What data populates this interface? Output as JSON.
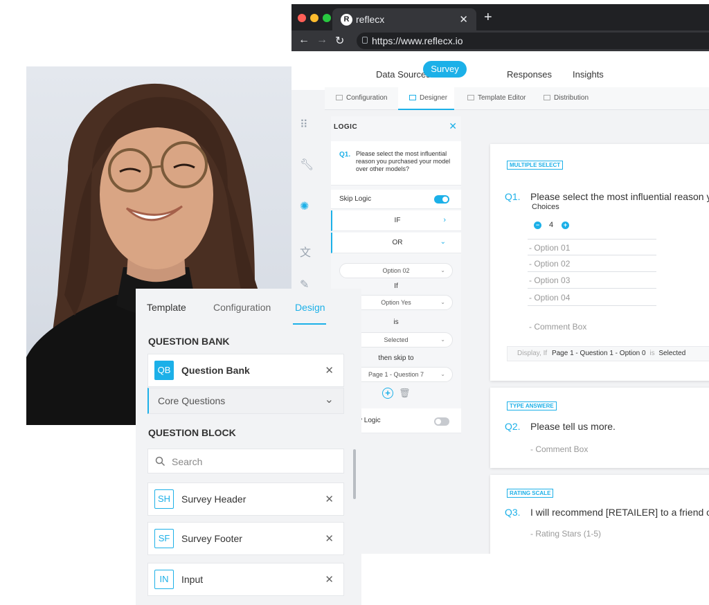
{
  "browser": {
    "tab_title": "reflecx",
    "tab_logo": "R",
    "url": "https://www.reflecx.io"
  },
  "topnav": {
    "items": [
      "Data Sources",
      "Survey",
      "Responses",
      "Insights"
    ],
    "active": "Survey"
  },
  "subtabs": [
    "Configuration",
    "Designer",
    "Template Editor",
    "Distribution"
  ],
  "logic": {
    "title": "LOGIC",
    "question_num": "Q1.",
    "question_text": "Please select the most influential reason you purchased your model over other models?",
    "skip_logic_label": "Skip Logic",
    "skip_logic_on": true,
    "if_label": "IF",
    "or_label": "OR",
    "option_select": "Option 02",
    "if_small": "If",
    "yes_select": "Option Yes",
    "is_label": "is",
    "selected_select": "Selected",
    "then_skip_label": "then skip to",
    "skip_target": "Page 1 - Question 7",
    "display_logic_label": "y Logic",
    "display_logic_on": false
  },
  "canvas": {
    "q1": {
      "type": "MULTIPLE SELECT",
      "num": "Q1.",
      "text": "Please select the most influential reason y",
      "choices_label": "Choices",
      "choices_count": "4",
      "options": [
        "- Option 01",
        "- Option 02",
        "- Option 03",
        "- Option 04"
      ],
      "comment": "- Comment Box",
      "display_prefix": "Display, If",
      "display_value": "Page 1 - Question 1 - Option 0",
      "display_is": "is",
      "display_state": "Selected"
    },
    "q2": {
      "type": "TYPE ANSWERE",
      "num": "Q2.",
      "text": "Please tell us more.",
      "comment": "- Comment Box"
    },
    "q3": {
      "type": "RATING SCALE",
      "num": "Q3.",
      "text": "I will recommend [RETAILER] to a friend o",
      "sub": "- Rating Stars (1-5)"
    }
  },
  "design": {
    "tabs": [
      "Template",
      "Configuration",
      "Design"
    ],
    "active_tab": "Design",
    "question_bank_heading": "QUESTION BANK",
    "qb_badge": "QB",
    "qb_label": "Question Bank",
    "core_questions": "Core Questions",
    "question_block_heading": "QUESTION BLOCK",
    "search_placeholder": "Search",
    "blocks": [
      {
        "badge": "SH",
        "label": "Survey Header"
      },
      {
        "badge": "SF",
        "label": "Survey Footer"
      },
      {
        "badge": "IN",
        "label": "Input"
      }
    ]
  },
  "colors": {
    "accent": "#1cb0e8",
    "chrome_dark": "#202124"
  }
}
